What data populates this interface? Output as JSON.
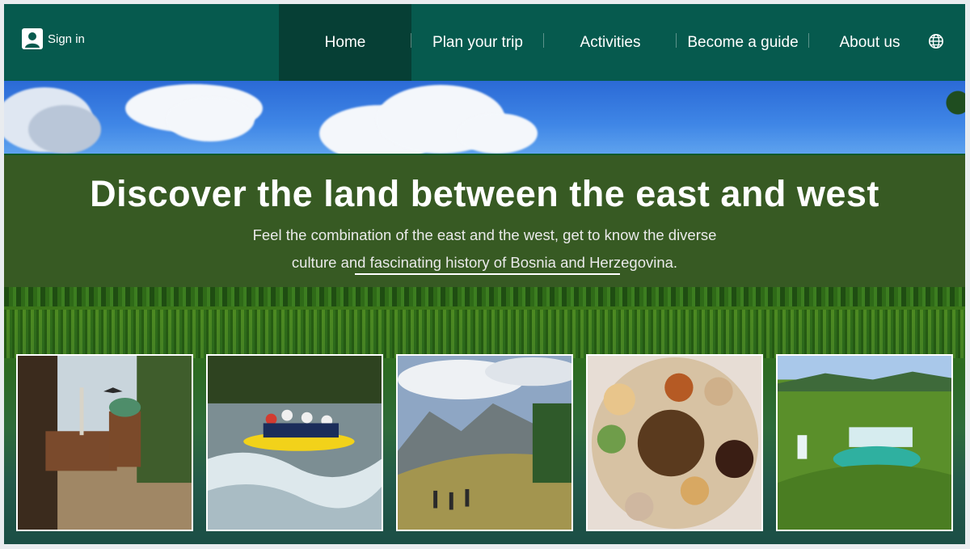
{
  "nav": {
    "sign_in": "Sign in",
    "items": [
      {
        "label": "Home",
        "active": true
      },
      {
        "label": "Plan your trip",
        "active": false
      },
      {
        "label": "Activities",
        "active": false
      },
      {
        "label": "Become a guide",
        "active": false
      },
      {
        "label": "About us",
        "active": false
      }
    ],
    "language_icon": "globe-icon",
    "user_icon": "user-icon"
  },
  "hero": {
    "title": "Discover the land between the east and west",
    "subtitle_line1": "Feel the combination of the east and the west, get to know the diverse",
    "subtitle_line2": "culture and fascinating history of Bosnia and Herzegovina."
  },
  "cards": [
    {
      "name": "sarajevo-fountain"
    },
    {
      "name": "rafting"
    },
    {
      "name": "hiking"
    },
    {
      "name": "food"
    },
    {
      "name": "waterfalls"
    }
  ],
  "colors": {
    "nav": "#065a4e",
    "nav_active": "#063f35",
    "hero_band": "#375a23"
  }
}
